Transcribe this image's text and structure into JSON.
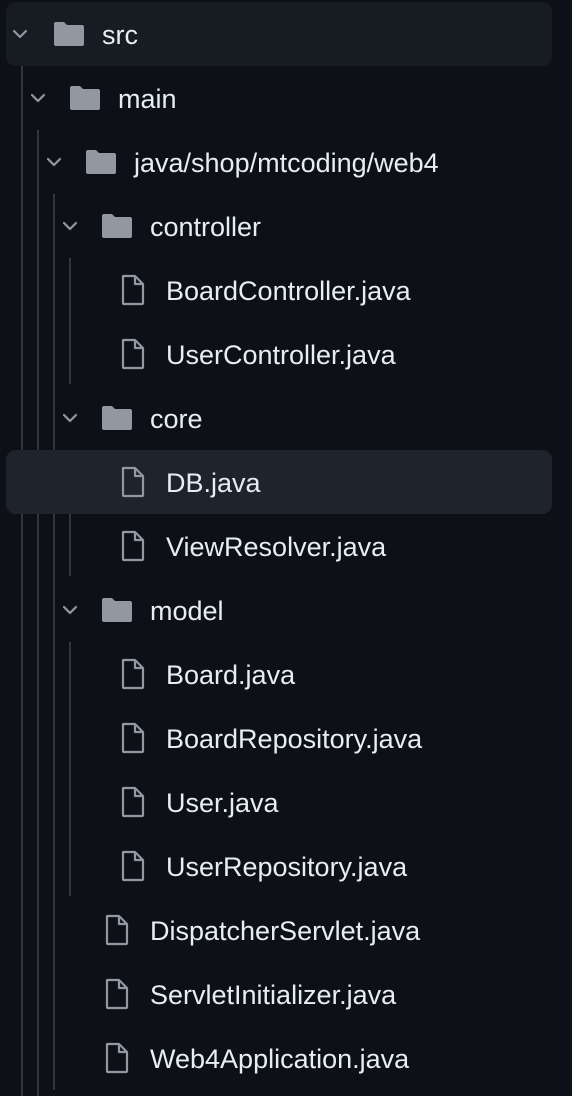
{
  "tree": {
    "src": {
      "label": "src"
    },
    "main": {
      "label": "main"
    },
    "package": {
      "label": "java/shop/mtcoding/web4"
    },
    "controller": {
      "label": "controller",
      "files": [
        "BoardController.java",
        "UserController.java"
      ]
    },
    "core": {
      "label": "core",
      "files": [
        "DB.java",
        "ViewResolver.java"
      ],
      "selected_file": "DB.java"
    },
    "model": {
      "label": "model",
      "files": [
        "Board.java",
        "BoardRepository.java",
        "User.java",
        "UserRepository.java"
      ]
    },
    "root_files": [
      "DispatcherServlet.java",
      "ServletInitializer.java",
      "Web4Application.java"
    ]
  },
  "icons": {
    "folder": "folder-icon",
    "file": "file-icon",
    "expand": "chevron-down-icon"
  },
  "colors": {
    "background": "#0d1117",
    "selected_row": "#1f242c",
    "text": "#e6edf3",
    "icon": "#9198a1",
    "guide": "#30363d"
  }
}
